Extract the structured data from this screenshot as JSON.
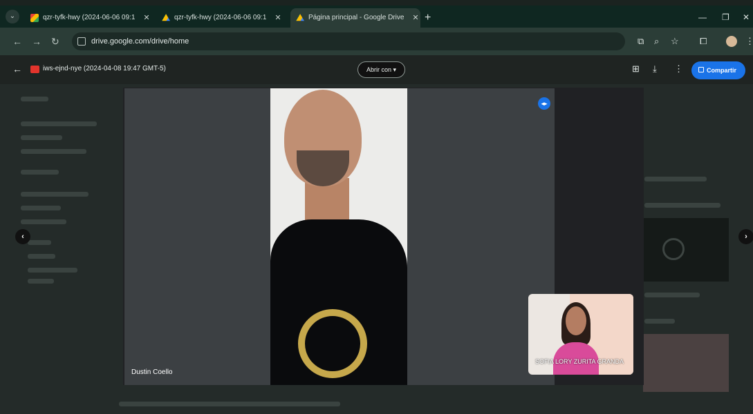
{
  "browser": {
    "tabs": [
      {
        "label": "qzr-tyfk-hwy (2024-06-06 09:1",
        "favicon": "gmail-icon",
        "active": false
      },
      {
        "label": "qzr-tyfk-hwy (2024-06-06 09:1",
        "favicon": "drive-icon",
        "active": false
      },
      {
        "label": "Página principal - Google Drive",
        "favicon": "drive-icon",
        "active": true
      }
    ],
    "new_tab": "+",
    "url": "drive.google.com/drive/home"
  },
  "viewer": {
    "file_name": "iws-ejnd-nye (2024-04-08 19:47 GMT-5)",
    "open_with": "Abrir con",
    "share_label": "Compartir"
  },
  "meeting": {
    "main_participant": "Dustin Coello",
    "pip_participant": "SOFIA LORY ZURITA GRANDA"
  },
  "colors": {
    "accent": "#1a73e8",
    "tab_bar": "#0f2721",
    "address_bar": "#2b3d37"
  }
}
